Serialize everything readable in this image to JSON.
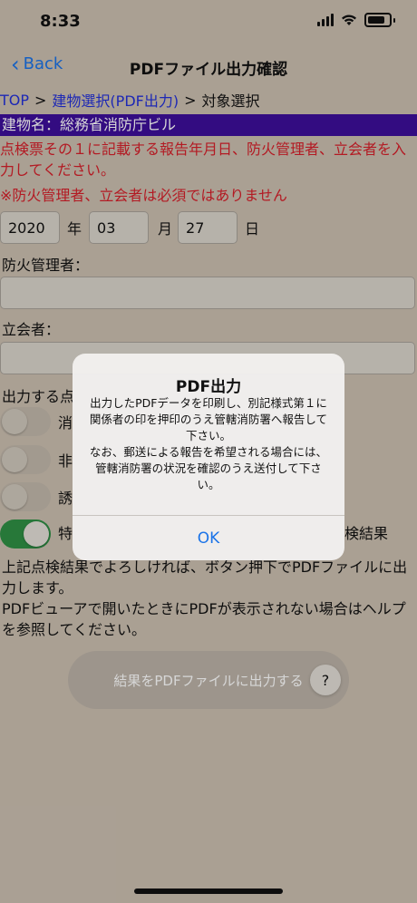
{
  "status": {
    "time": "8:33"
  },
  "nav": {
    "back_label": "Back",
    "title": "PDFファイル出力確認"
  },
  "breadcrumb": {
    "top": "TOP",
    "sep1": ">",
    "building": "建物選択(PDF出力)",
    "sep2": ">",
    "current": "対象選択"
  },
  "building": {
    "label": "建物名：総務省消防庁ビル"
  },
  "instructions": {
    "line1": "点検票その１に記載する報告年月日、防火管理者、立会者を入力してください。",
    "line2": "※防火管理者、立会者は必須ではありません"
  },
  "date": {
    "year": "2020",
    "year_unit": "年",
    "month": "03",
    "month_unit": "月",
    "day": "27",
    "day_unit": "日"
  },
  "fields": {
    "manager_label": "防火管理者：",
    "witness_label": "立会者："
  },
  "output": {
    "heading": "出力する点",
    "options": [
      {
        "label": "消",
        "on": false
      },
      {
        "label": "非",
        "on": false
      },
      {
        "label": "誘",
        "on": false
      },
      {
        "label": "特",
        "label_right": "検結果",
        "on": true
      }
    ]
  },
  "body": {
    "text": "上記点検結果でよろしければ、ボタン押下でPDFファイルに出力します。\nPDFビューアで開いたときにPDFが表示されない場合はヘルプを参照してください。"
  },
  "buttons": {
    "pdf_output": "結果をPDFファイルに出力する",
    "help": "?"
  },
  "alert": {
    "title": "PDF出力",
    "message": "出力したPDFデータを印刷し、別記様式第１に関係者の印を押印のうえ管轄消防署へ報告して下さい。\nなお、郵送による報告を希望される場合には、管轄消防署の状況を確認のうえ送付して下さい。",
    "ok": "OK"
  }
}
